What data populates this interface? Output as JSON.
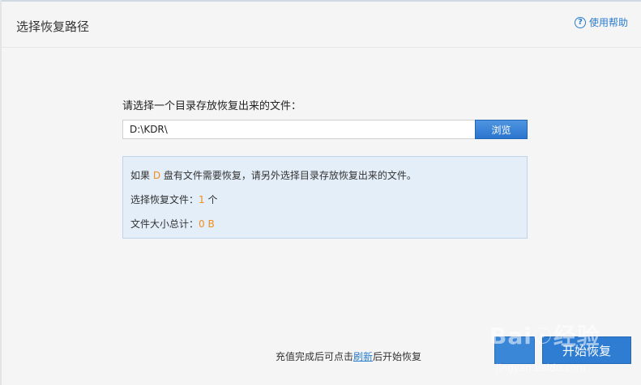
{
  "header": {
    "title": "选择恢复路径",
    "help_label": "使用帮助"
  },
  "main": {
    "prompt": "请选择一个目录存放恢复出来的文件：",
    "path_value": "D:\\KDR\\",
    "browse_label": "浏览"
  },
  "info": {
    "line1_prefix": "如果",
    "drive": "D",
    "line1_suffix": "盘有文件需要恢复，请另外选择目录存放恢复出来的文件。",
    "selected_label": "选择恢复文件：",
    "selected_count": "1",
    "selected_unit": "个",
    "size_label": "文件大小总计：",
    "size_value": "0 B"
  },
  "footer": {
    "note_prefix": "充值完成后可点击",
    "refresh_link": "刷新",
    "note_suffix": "后开始恢复",
    "start_label": "开始恢复"
  },
  "colors": {
    "accent": "#2f7dd3",
    "highlight": "#f08c1e",
    "info_bg": "#e3eef8"
  }
}
